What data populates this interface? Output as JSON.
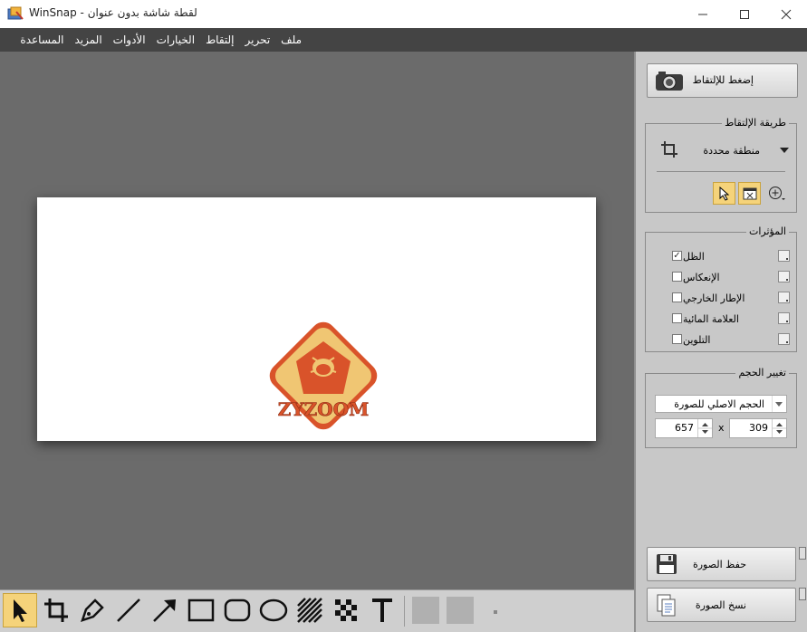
{
  "window": {
    "title": "WinSnap - لقطة شاشة بدون عنوان"
  },
  "menu": {
    "items": [
      {
        "label": "ملف"
      },
      {
        "label": "تحرير"
      },
      {
        "label": "إلتقاط"
      },
      {
        "label": "الخيارات"
      },
      {
        "label": "الأدوات"
      },
      {
        "label": "المزيد"
      },
      {
        "label": "المساعدة"
      }
    ]
  },
  "capture": {
    "button_label": "إضغط للإلتقاط",
    "method_title": "طريقة الإلتقاط",
    "method_value": "منطقة محددة"
  },
  "effects": {
    "title": "المؤثرات",
    "items": [
      {
        "label": "الظل",
        "checked": true
      },
      {
        "label": "الإنعكاس",
        "checked": false
      },
      {
        "label": "الإطار الخارجي",
        "checked": false
      },
      {
        "label": "العلامة المائية",
        "checked": false
      },
      {
        "label": "التلوين",
        "checked": false
      }
    ]
  },
  "resize": {
    "title": "تغيير الحجم",
    "mode": "الحجم الاصلي للصورة",
    "width": "657",
    "separator": "x",
    "height": "309"
  },
  "actions": {
    "save_label": "حفظ الصورة",
    "copy_label": "نسخ الصورة"
  },
  "image": {
    "logo_text": "ZYZOOM"
  },
  "colors": {
    "accent": "#f5d37a",
    "logo_orange": "#d9532a",
    "logo_yellow": "#f0c673"
  }
}
